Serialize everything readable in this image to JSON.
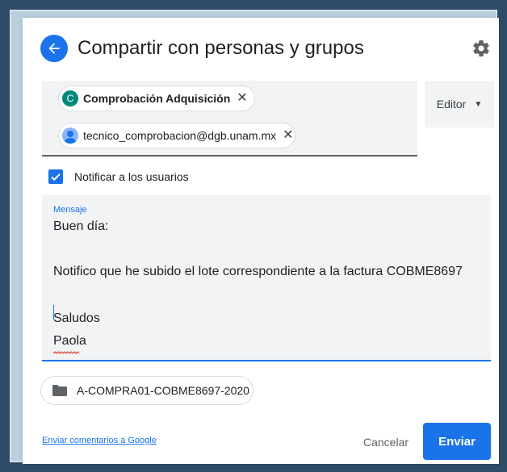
{
  "header": {
    "title": "Compartir con personas y grupos"
  },
  "recipients": [
    {
      "avatar_letter": "C",
      "label": "Comprobación Adquisición"
    },
    {
      "avatar_letter": "",
      "label": "tecnico_comprobacion@dgb.unam.mx"
    }
  ],
  "role": {
    "label": "Editor"
  },
  "notify": {
    "label": "Notificar a los usuarios",
    "checked": true
  },
  "message": {
    "label": "Mensaje",
    "lines": [
      "Buen día:",
      "",
      "Notifico que he subido el lote correspondiente a la factura COBME8697",
      "",
      "Saludos",
      "Paola"
    ]
  },
  "attachment": {
    "label": "A-COMPRA01-COBME8697-2020"
  },
  "footer": {
    "feedback_link": "Enviar comentarios a Google",
    "cancel_label": "Cancelar",
    "send_label": "Enviar"
  },
  "colors": {
    "accent": "#1a73e8",
    "frame": "#2e4b67",
    "field_bg": "#f1f3f4"
  }
}
